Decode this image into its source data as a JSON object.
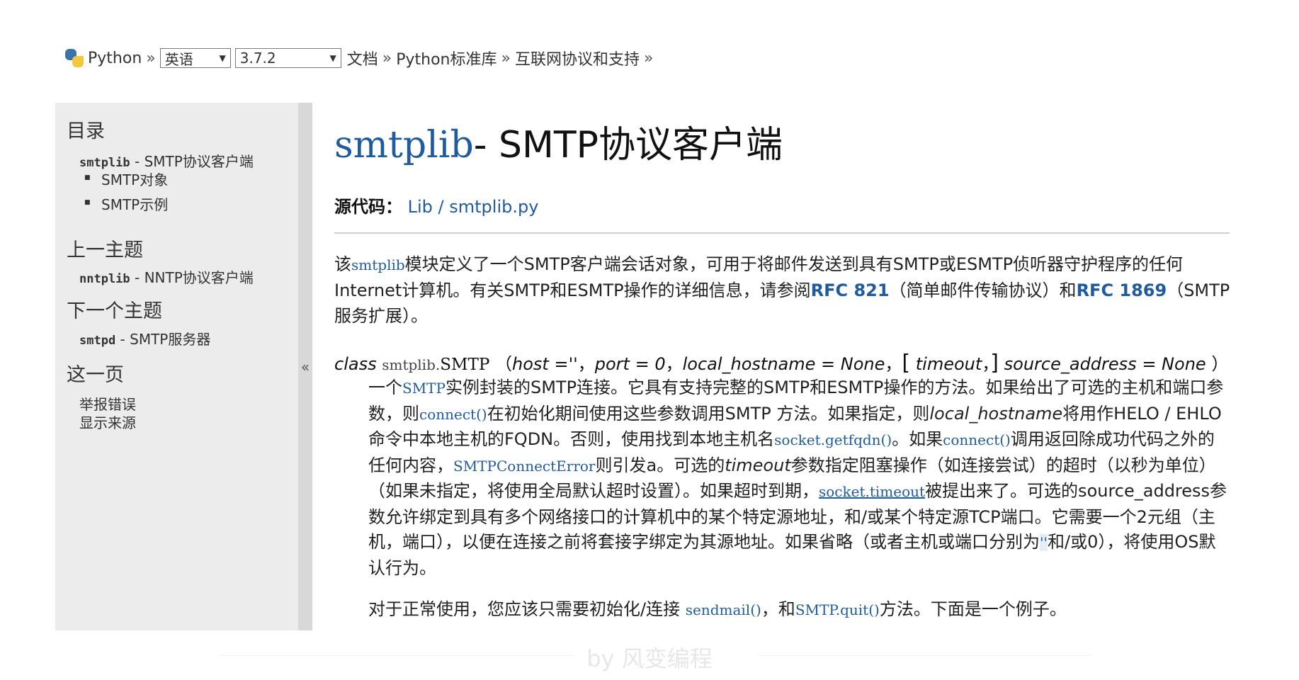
{
  "breadcrumb": {
    "python": "Python",
    "sep": "»",
    "language": "英语",
    "version": "3.7.2",
    "docs": "文档",
    "stdlib": "Python标准库",
    "section": "互联网协议和支持"
  },
  "sidebar": {
    "toc_heading": "目录",
    "toc_module": "smtplib",
    "toc_title": " - SMTP协议客户端",
    "toc_items": [
      "SMTP对象",
      "SMTP示例"
    ],
    "prev_heading": "上一主题",
    "prev_module": "nntplib",
    "prev_title": " - NNTP协议客户端",
    "next_heading": "下一个主题",
    "next_module": "smtpd",
    "next_title": " - SMTP服务器",
    "page_heading": "这一页",
    "report_bug": "举报错误",
    "show_source": "显示来源",
    "collapse": "«"
  },
  "main": {
    "title_module": "smtplib",
    "title_text": "- SMTP协议客户端",
    "source_label": "源代码：",
    "source_link": "Lib / smtplib.py",
    "intro": {
      "p1": "该",
      "code": "smtplib",
      "p2": "模块定义了一个SMTP客户端会话对象，可用于将邮件发送到具有SMTP或ESMTP侦听器守护程序的任何Internet计算机。有关SMTP和ESMTP操作的详细信息，请参阅",
      "rfc821": "RFC 821",
      "p3": "（简单邮件传输协议）和",
      "rfc1869": "RFC 1869",
      "p4": "（SMTP服务扩展）。"
    },
    "signature": {
      "kw": "class",
      "prefix": "smtplib.",
      "name": "SMTP",
      "open": "（",
      "a1": "host =''",
      "comma": "，",
      "a2": "port = 0",
      "a3": "local_hostname = None",
      "lb": "[",
      "a4": "timeout",
      "rb": "]",
      "a5": "source_address = None",
      "close": "）"
    },
    "desc": {
      "t1": "一个",
      "c1": "SMTP",
      "t2": "实例封装的SMTP连接。它具有支持完整的SMTP和ESMTP操作的方法。如果给出了可选的主机和端口参数，则",
      "c2": "connect()",
      "t3": "在初始化期间使用这些参数调用SMTP 方法。如果指定，则",
      "e1": "local_hostname",
      "t4": "将用作HELO / EHLO命令中本地主机的FQDN。否则，使用找到本地主机名",
      "c3": "socket.getfqdn()",
      "t5": "。如果",
      "c4": "connect()",
      "t6": "调用返回除成功代码之外的任何内容，",
      "c5": "SMTPConnectError",
      "t7": "则引发a。可选的",
      "e2": "timeout",
      "t8": "参数指定阻塞操作（如连接尝试）的超时（以秒为单位）（如果未指定，将使用全局默认超时设置）。如果超时到期，",
      "c6": "socket.timeout",
      "t9": "被提出来了。可选的source_address参数允许绑定到具有多个网络接口的计算机中的某个特定源地址，和/或某个特定源TCP端口。它需要一个2元组（主机，端口），以便在连接之前将套接字绑定为其源地址。如果省略（或者主机或端口分别为",
      "c7": "''",
      "t10": "和/或0），将使用OS默认行为。"
    },
    "usage": {
      "t1": "对于正常使用，您应该只需要初始化/连接",
      "c1": "sendmail()",
      "t2": "，和",
      "c2": "SMTP.quit()",
      "t3": "方法。下面是一个例子。"
    }
  },
  "watermark": "by 风变编程"
}
